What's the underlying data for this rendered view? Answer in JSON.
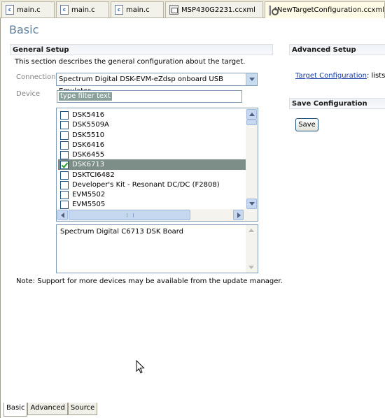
{
  "tabs": [
    {
      "label": "main.c",
      "icon": "c-file-icon"
    },
    {
      "label": "main.c",
      "icon": "c-file-icon"
    },
    {
      "label": "main.c",
      "icon": "c-file-icon"
    },
    {
      "label": "MSP430G2231.ccxml",
      "icon": "xml-file-icon"
    },
    {
      "label": "*NewTargetConfiguration.ccxml",
      "icon": "target-config-icon"
    }
  ],
  "page": {
    "title": "Basic"
  },
  "general_setup": {
    "title": "General Setup",
    "description": "This section describes the general configuration about the target.",
    "connection_label": "Connection",
    "connection_value": "Spectrum Digital DSK-EVM-eZdsp onboard USB Emulator",
    "device_label": "Device",
    "filter_placeholder": "type filter text",
    "devices": [
      {
        "label": "DSK5416",
        "checked": false
      },
      {
        "label": "DSK5509A",
        "checked": false
      },
      {
        "label": "DSK5510",
        "checked": false
      },
      {
        "label": "DSK6416",
        "checked": false
      },
      {
        "label": "DSK6455",
        "checked": false
      },
      {
        "label": "DSK6713",
        "checked": true
      },
      {
        "label": "DSKTCI6482",
        "checked": false
      },
      {
        "label": "Developer's Kit - Resonant DC/DC (F2808)",
        "checked": false
      },
      {
        "label": "EVM5502",
        "checked": false
      },
      {
        "label": "EVM5505",
        "checked": false
      }
    ],
    "selected_description": "Spectrum Digital C6713 DSK Board",
    "note": "Note: Support for more devices may be available from the update manager."
  },
  "advanced_setup": {
    "title": "Advanced Setup",
    "link_text": "Target Configuration",
    "link_rest": ": lists th"
  },
  "save_configuration": {
    "title": "Save Configuration",
    "save_label": "Save"
  },
  "bottom_tabs": [
    "Basic",
    "Advanced",
    "Source"
  ],
  "colors": {
    "selection": "#7c8e87",
    "title": "#5d7d9a",
    "link": "#1a3fa6"
  }
}
